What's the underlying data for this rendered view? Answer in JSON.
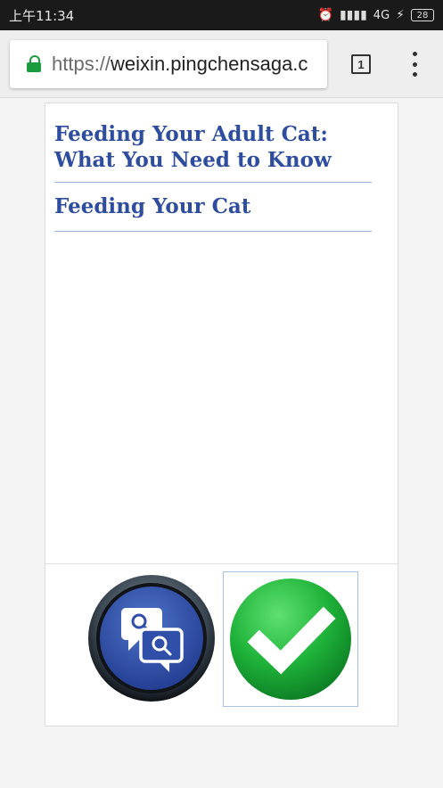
{
  "status_bar": {
    "time": "上午11:34",
    "alarm_icon": "alarm-clock-icon",
    "signal_icon": "signal-icon",
    "network": "4G",
    "charging_icon": "charging-icon",
    "battery": "28"
  },
  "browser": {
    "url_scheme": "https://",
    "url_host": "weixin.pingchensaga.c",
    "tab_count": "1",
    "lock_icon": "lock-icon",
    "menu_icon": "more-vert-icon",
    "secure_color": "#1a9c3e"
  },
  "articles": [
    {
      "title": "Feeding Your Adult Cat: What You Need to Know"
    },
    {
      "title": "Feeding Your Cat"
    }
  ],
  "actions": {
    "search_icon": "search-chat-icon",
    "check_icon": "check-icon"
  },
  "colors": {
    "link": "#2e4d9e",
    "check_green": "#1fb33a",
    "search_blue": "#2f4fa8"
  }
}
